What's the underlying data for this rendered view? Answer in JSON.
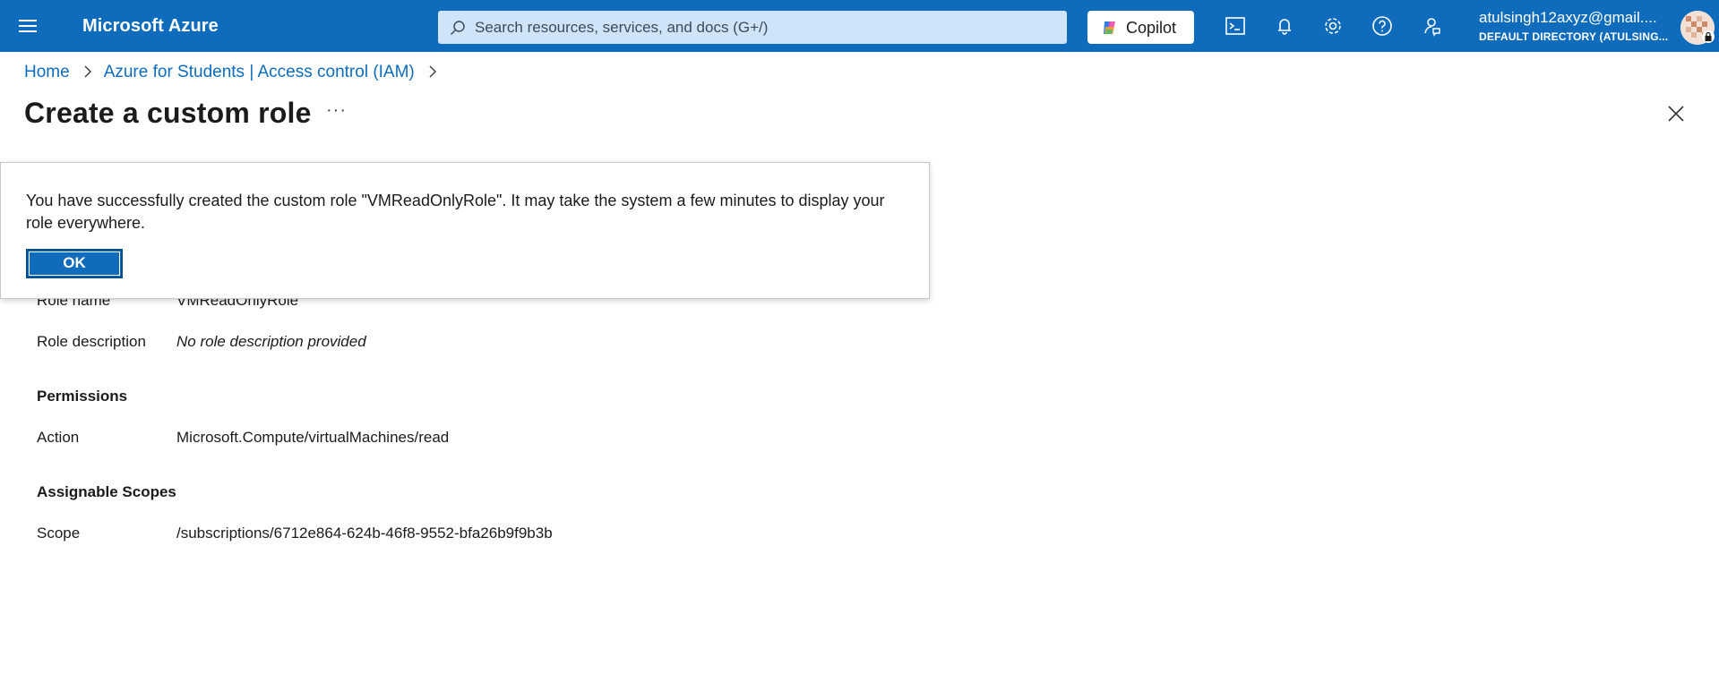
{
  "topbar": {
    "brand": "Microsoft Azure",
    "search_placeholder": "Search resources, services, and docs (G+/)",
    "copilot_label": "Copilot",
    "account_email": "atulsingh12axyz@gmail....",
    "account_directory": "DEFAULT DIRECTORY (ATULSING...",
    "icons": [
      "hamburger-icon",
      "search-icon",
      "copilot-icon",
      "cloud-shell-icon",
      "bell-icon",
      "gear-icon",
      "help-icon",
      "feedback-icon",
      "avatar",
      "lock-icon"
    ],
    "accent_color": "#0f6cbd"
  },
  "breadcrumb": {
    "items": [
      "Home",
      "Azure for Students | Access control (IAM)"
    ]
  },
  "page": {
    "title": "Create a custom role",
    "more_label": "···"
  },
  "details": {
    "role_name_label": "Role name",
    "role_name_value": "VMReadOnlyRole",
    "role_description_label": "Role description",
    "role_description_value": "No role description provided",
    "permissions_heading": "Permissions",
    "action_label": "Action",
    "action_value": "Microsoft.Compute/virtualMachines/read",
    "scopes_heading": "Assignable Scopes",
    "scope_label": "Scope",
    "scope_value": "/subscriptions/6712e864-624b-46f8-9552-bfa26b9f9b3b"
  },
  "dialog": {
    "message": "You have successfully created the custom role \"VMReadOnlyRole\". It may take the system a few minutes to display your role everywhere.",
    "ok_label": "OK"
  }
}
